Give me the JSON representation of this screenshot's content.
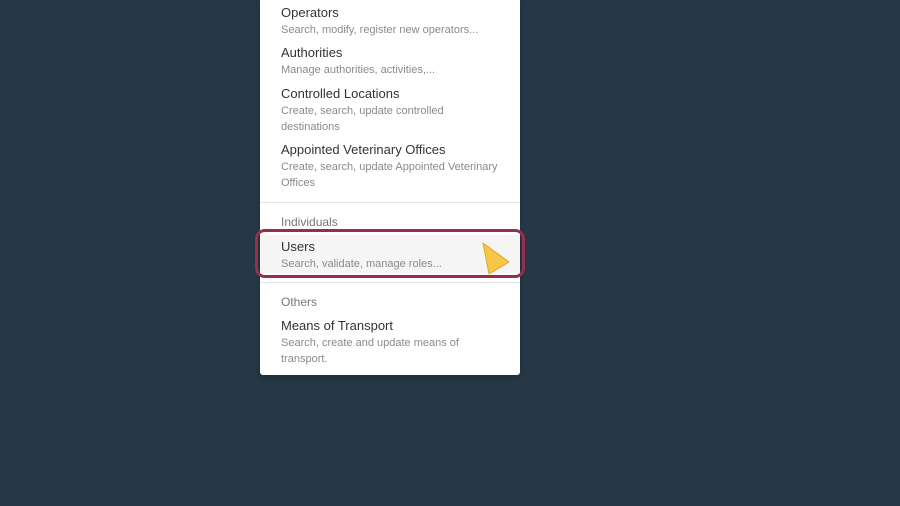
{
  "menu": {
    "top_items": [
      {
        "title": "Operators",
        "desc": "Search, modify, register new operators..."
      },
      {
        "title": "Authorities",
        "desc": "Manage authorities, activities,..."
      },
      {
        "title": "Controlled Locations",
        "desc_line1": "Create, search, update controlled",
        "desc_line2": "destinations"
      },
      {
        "title": "Appointed Veterinary Offices",
        "desc_line1": "Create, search, update Appointed Veterinary",
        "desc_line2": "Offices"
      }
    ],
    "individuals": {
      "header": "Individuals",
      "users": {
        "title": "Users",
        "desc": "Search, validate, manage roles..."
      }
    },
    "others": {
      "header": "Others",
      "transport": {
        "title": "Means of Transport",
        "desc_line1": "Search, create and update means of",
        "desc_line2": "transport."
      }
    }
  },
  "colors": {
    "background": "#263845",
    "panel": "#ffffff",
    "highlight_ring": "#96304a",
    "cursor": "#f7c548"
  },
  "icons": {
    "cursor": "pointer-arrow-icon"
  }
}
